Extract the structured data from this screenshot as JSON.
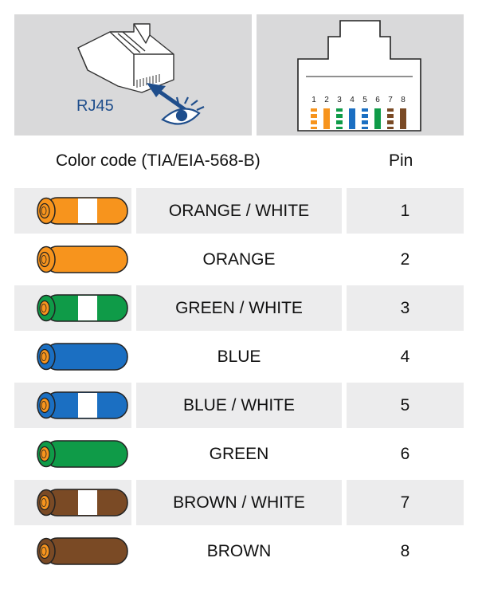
{
  "connector_label": "RJ45",
  "pin_numbers": [
    "1",
    "2",
    "3",
    "4",
    "5",
    "6",
    "7",
    "8"
  ],
  "header": {
    "color_code": "Color code (TIA/EIA-568-B)",
    "pin": "Pin"
  },
  "colors": {
    "orange": "#f7941d",
    "green": "#0f9b48",
    "blue": "#1b6fc2",
    "brown": "#7a4a25",
    "white": "#ffffff",
    "accent": "#1f4e8c"
  },
  "rows": [
    {
      "name": "ORANGE / WHITE",
      "pin": "1",
      "color": "orange",
      "striped": true
    },
    {
      "name": "ORANGE",
      "pin": "2",
      "color": "orange",
      "striped": false
    },
    {
      "name": "GREEN / WHITE",
      "pin": "3",
      "color": "green",
      "striped": true
    },
    {
      "name": "BLUE",
      "pin": "4",
      "color": "blue",
      "striped": false
    },
    {
      "name": "BLUE / WHITE",
      "pin": "5",
      "color": "blue",
      "striped": true
    },
    {
      "name": "GREEN",
      "pin": "6",
      "color": "green",
      "striped": false
    },
    {
      "name": "BROWN / WHITE",
      "pin": "7",
      "color": "brown",
      "striped": true
    },
    {
      "name": "BROWN",
      "pin": "8",
      "color": "brown",
      "striped": false
    }
  ]
}
